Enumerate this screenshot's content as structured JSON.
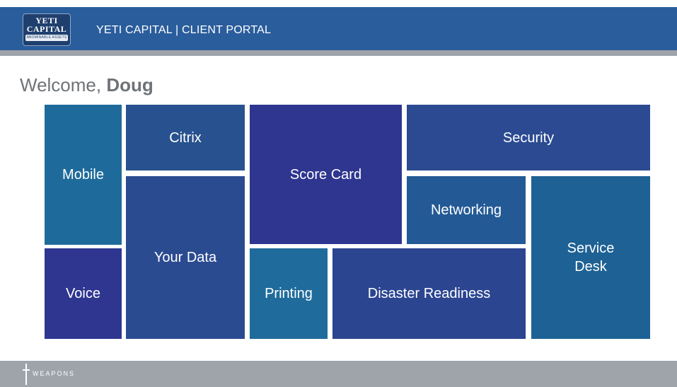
{
  "header": {
    "logo_line1": "YETI",
    "logo_line2": "CAPITAL",
    "logo_tagline": "ABOMINABLE ASSETS",
    "title": "YETI CAPITAL | CLIENT PORTAL"
  },
  "welcome": {
    "prefix": "Welcome, ",
    "name": "Doug"
  },
  "tiles": {
    "mobile": "Mobile",
    "citrix": "Citrix",
    "score_card": "Score Card",
    "security": "Security",
    "networking": "Networking",
    "your_data": "Your Data",
    "service_desk": "Service Desk",
    "voice": "Voice",
    "printing": "Printing",
    "disaster_readiness": "Disaster Readiness"
  },
  "footer": {
    "brand": "WEAPONS"
  },
  "colors": {
    "header": "#2a5d9c",
    "tile_teal": "#1e6b9b",
    "tile_navy": "#2b4b91",
    "tile_indigo": "#2e3690",
    "footer": "#9ea4aa"
  }
}
